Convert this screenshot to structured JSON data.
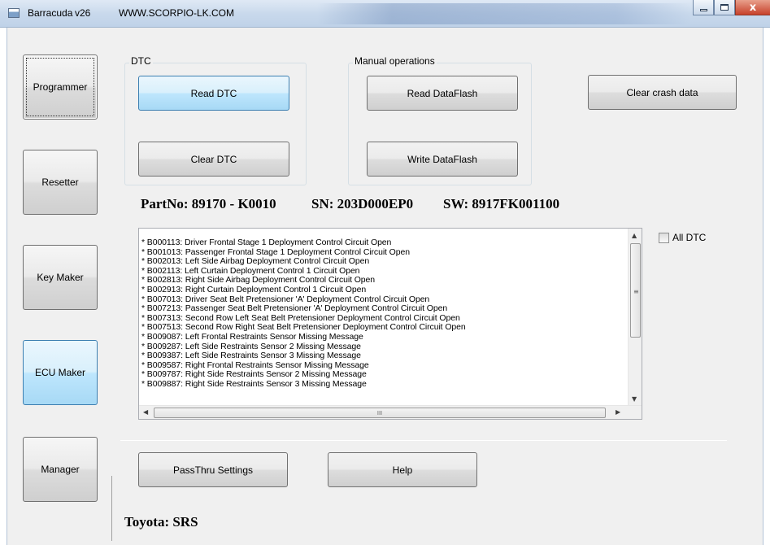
{
  "titlebar": {
    "app_name": "Barracuda",
    "version": "v26",
    "website": "WWW.SCORPIO-LK.COM",
    "close_glyph": "x"
  },
  "nav": {
    "items": [
      {
        "label": "Programmer"
      },
      {
        "label": "Resetter"
      },
      {
        "label": "Key Maker"
      },
      {
        "label": "ECU Maker"
      },
      {
        "label": "Manager"
      }
    ]
  },
  "dtc_group": {
    "title": "DTC",
    "read_label": "Read DTC",
    "clear_label": "Clear DTC"
  },
  "manual_group": {
    "title": "Manual operations",
    "read_flash_label": "Read DataFlash",
    "write_flash_label": "Write DataFlash"
  },
  "clear_crash_label": "Clear crash data",
  "ecu_info": {
    "part_no": "PartNo: 89170 - K0010",
    "sn": "SN: 203D000EP0",
    "sw": "SW: 8917FK001100"
  },
  "all_dtc_label": "All DTC",
  "dtc_list": [
    "* B000113: Driver Frontal Stage 1 Deployment Control Circuit Open",
    "* B001013: Passenger Frontal Stage 1 Deployment Control Circuit Open",
    "* B002013: Left Side Airbag Deployment Control Circuit Open",
    "* B002113: Left Curtain Deployment Control 1 Circuit Open",
    "* B002813: Right Side Airbag Deployment Control Circuit Open",
    "* B002913: Right Curtain Deployment Control 1 Circuit Open",
    "* B007013: Driver Seat Belt Pretensioner 'A' Deployment Control Circuit Open",
    "* B007213: Passenger Seat Belt Pretensioner 'A' Deployment Control Circuit Open",
    "* B007313: Second Row Left Seat Belt Pretensioner Deployment Control Circuit Open",
    "* B007513: Second Row Right Seat Belt Pretensioner Deployment Control Circuit Open",
    "* B009087: Left Frontal Restraints Sensor Missing Message",
    "* B009287: Left Side Restraints Sensor 2 Missing Message",
    "* B009387: Left Side Restraints Sensor 3 Missing Message",
    "* B009587: Right Frontal Restraints Sensor Missing Message",
    "* B009787: Right Side Restraints Sensor 2 Missing Message",
    "* B009887: Right Side Restraints Sensor 3 Missing Message"
  ],
  "scroll_glyphs": {
    "up": "▲",
    "down": "▼",
    "left": "◀",
    "right": "▶",
    "grip_v": "≡",
    "grip_h": "III"
  },
  "footer_buttons": {
    "passthru_label": "PassThru Settings",
    "help_label": "Help"
  },
  "status": {
    "vehicle_module": "Toyota: SRS"
  }
}
